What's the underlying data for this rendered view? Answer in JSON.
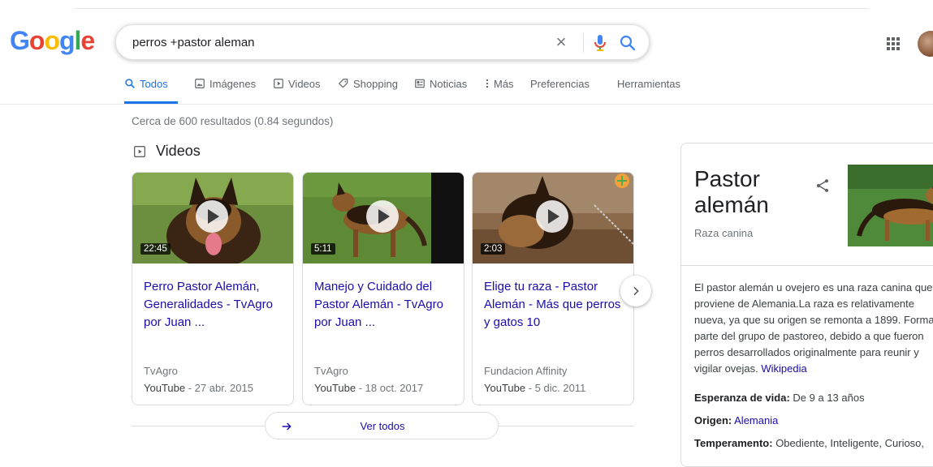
{
  "logo": {
    "letters": [
      {
        "ch": "G",
        "color": "#4285F4"
      },
      {
        "ch": "o",
        "color": "#EA4335"
      },
      {
        "ch": "o",
        "color": "#FBBC05"
      },
      {
        "ch": "g",
        "color": "#4285F4"
      },
      {
        "ch": "l",
        "color": "#34A853"
      },
      {
        "ch": "e",
        "color": "#EA4335"
      }
    ]
  },
  "search": {
    "query": "perros +pastor aleman",
    "clear_icon": "×"
  },
  "tabs": [
    {
      "label": "Todos",
      "icon": "search-icon",
      "active": true
    },
    {
      "label": "Imágenes",
      "icon": "image-icon"
    },
    {
      "label": "Videos",
      "icon": "video-icon"
    },
    {
      "label": "Shopping",
      "icon": "tag-icon"
    },
    {
      "label": "Noticias",
      "icon": "news-icon"
    },
    {
      "label": "Más",
      "icon": "more-icon"
    },
    {
      "label": "Preferencias"
    },
    {
      "label": "Herramientas"
    }
  ],
  "result_stats": "Cerca de 600 resultados (0.84 segundos)",
  "videos": {
    "header": "Videos",
    "items": [
      {
        "title": "Perro Pastor Alemán, Generalidades - TvAgro por Juan ...",
        "source": "TvAgro",
        "platform": "YouTube",
        "date": "27 abr. 2015",
        "duration": "22:45"
      },
      {
        "title": "Manejo y Cuidado del Pastor Alemán - TvAgro por Juan ...",
        "source": "TvAgro",
        "platform": "YouTube",
        "date": "18 oct. 2017",
        "duration": "5:11"
      },
      {
        "title": "Elige tu raza - Pastor Alemán - Más que perros y gatos 10",
        "source": "Fundacion Affinity",
        "platform": "YouTube",
        "date": "5 dic. 2011",
        "duration": "2:03"
      }
    ],
    "see_all": "Ver todos",
    "date_separator": " - "
  },
  "knowledge_panel": {
    "title": "Pastor alemán",
    "subtitle": "Raza canina",
    "description": "El pastor alemán u ovejero es una raza canina que proviene de Alemania.La raza es relativamente nueva, ya que su origen se remonta a 1899. Forma parte del grupo de pastoreo, debido a que fueron perros desarrollados originalmente para reunir y vigilar ovejas.",
    "source_link": "Wikipedia",
    "facts": [
      {
        "label": "Esperanza de vida:",
        "value": "De 9 a 13 años",
        "link": false
      },
      {
        "label": "Origen:",
        "value": "Alemania",
        "link": true
      },
      {
        "label": "Temperamento:",
        "value": "Obediente, Inteligente, Curioso,",
        "link": false
      }
    ]
  },
  "colors": {
    "accent": "#1a73e8",
    "link": "#1a0dab",
    "secondary_text": "#70757a"
  }
}
